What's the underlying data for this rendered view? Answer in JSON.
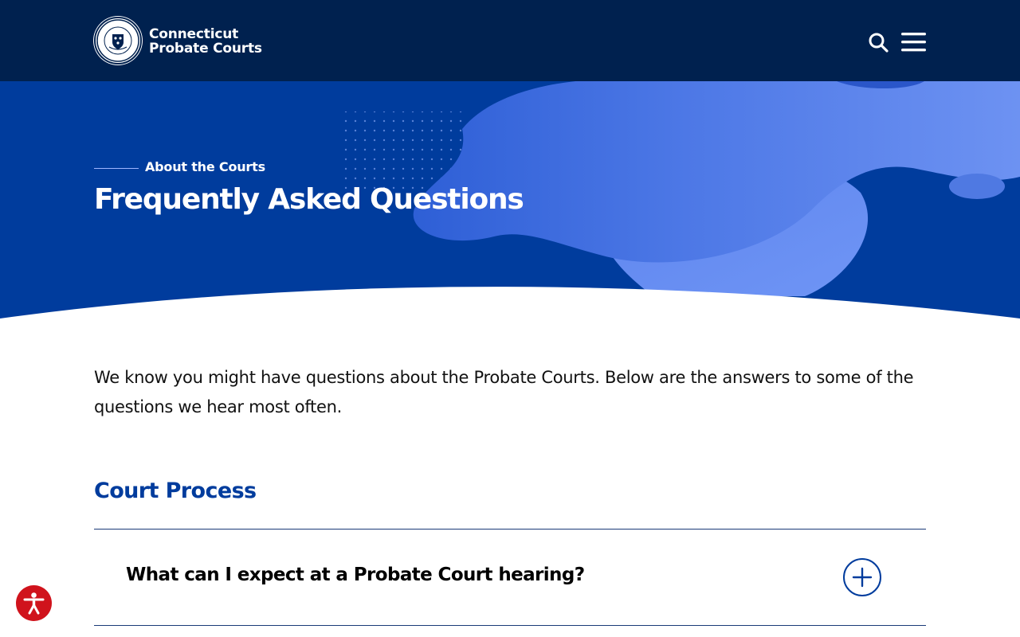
{
  "site": {
    "name_line1": "Connecticut",
    "name_line2": "Probate Courts",
    "seal_text_top": "CONNECTICUT",
    "seal_text_bottom": "PROBATE COURTS"
  },
  "header": {
    "search_icon": "search-icon",
    "menu_icon": "hamburger-menu-icon",
    "background_color": "#00214f"
  },
  "hero": {
    "eyebrow": "About the Courts",
    "title": "Frequently Asked Questions",
    "background_color": "#003c9d"
  },
  "main": {
    "intro": "We know you might have questions about the Probate Courts. Below are the answers to some of the questions we hear most often.",
    "sections": [
      {
        "heading": "Court Process",
        "items": [
          {
            "question": "What can I expect at a Probate Court hearing?",
            "expanded": false,
            "toggle_icon": "plus-circle-icon"
          }
        ]
      }
    ]
  },
  "accessibility": {
    "icon": "accessibility-person-icon",
    "color": "#d0131c"
  },
  "colors": {
    "accent": "#003c9d",
    "heading": "#003c9d",
    "text": "#111111"
  }
}
